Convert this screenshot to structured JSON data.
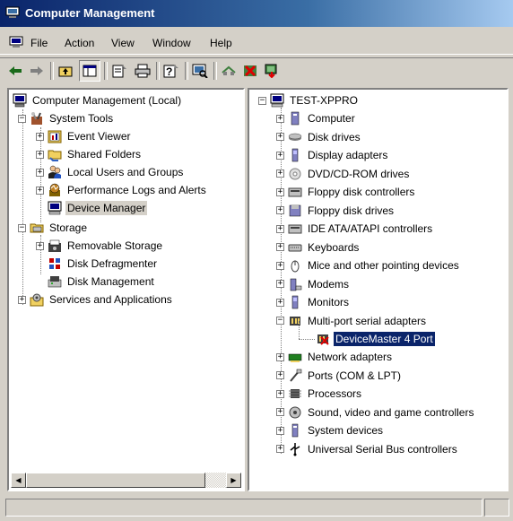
{
  "window": {
    "title": "Computer Management"
  },
  "menu": {
    "items": [
      "File",
      "Action",
      "View",
      "Window",
      "Help"
    ]
  },
  "toolbar": {
    "buttons": [
      "back-icon",
      "forward-icon",
      "up-folder-icon",
      "show-hide-console-tree-icon",
      "properties-icon",
      "print-icon",
      "help-icon",
      "scan-hardware-icon",
      "disable-device-icon",
      "uninstall-device-icon",
      "update-driver-icon"
    ]
  },
  "left_tree": {
    "root": "Computer Management (Local)",
    "system_tools": "System Tools",
    "event_viewer": "Event Viewer",
    "shared_folders": "Shared Folders",
    "local_users": "Local Users and Groups",
    "perf_logs": "Performance Logs and Alerts",
    "device_manager": "Device Manager",
    "storage": "Storage",
    "removable_storage": "Removable Storage",
    "disk_defrag": "Disk Defragmenter",
    "disk_mgmt": "Disk Management",
    "services": "Services and Applications"
  },
  "right_tree": {
    "root": "TEST-XPPRO",
    "categories": [
      "Computer",
      "Disk drives",
      "Display adapters",
      "DVD/CD-ROM drives",
      "Floppy disk controllers",
      "Floppy disk drives",
      "IDE ATA/ATAPI controllers",
      "Keyboards",
      "Mice and other pointing devices",
      "Modems",
      "Monitors",
      "Multi-port serial adapters"
    ],
    "selected_device": "DeviceMaster 4 Port",
    "categories_after": [
      "Network adapters",
      "Ports (COM & LPT)",
      "Processors",
      "Sound, video and game controllers",
      "System devices",
      "Universal Serial Bus controllers"
    ]
  },
  "colors": {
    "selection": "#0a246a",
    "title_start": "#0a246a",
    "title_end": "#a6caf0",
    "face": "#d4d0c8"
  }
}
